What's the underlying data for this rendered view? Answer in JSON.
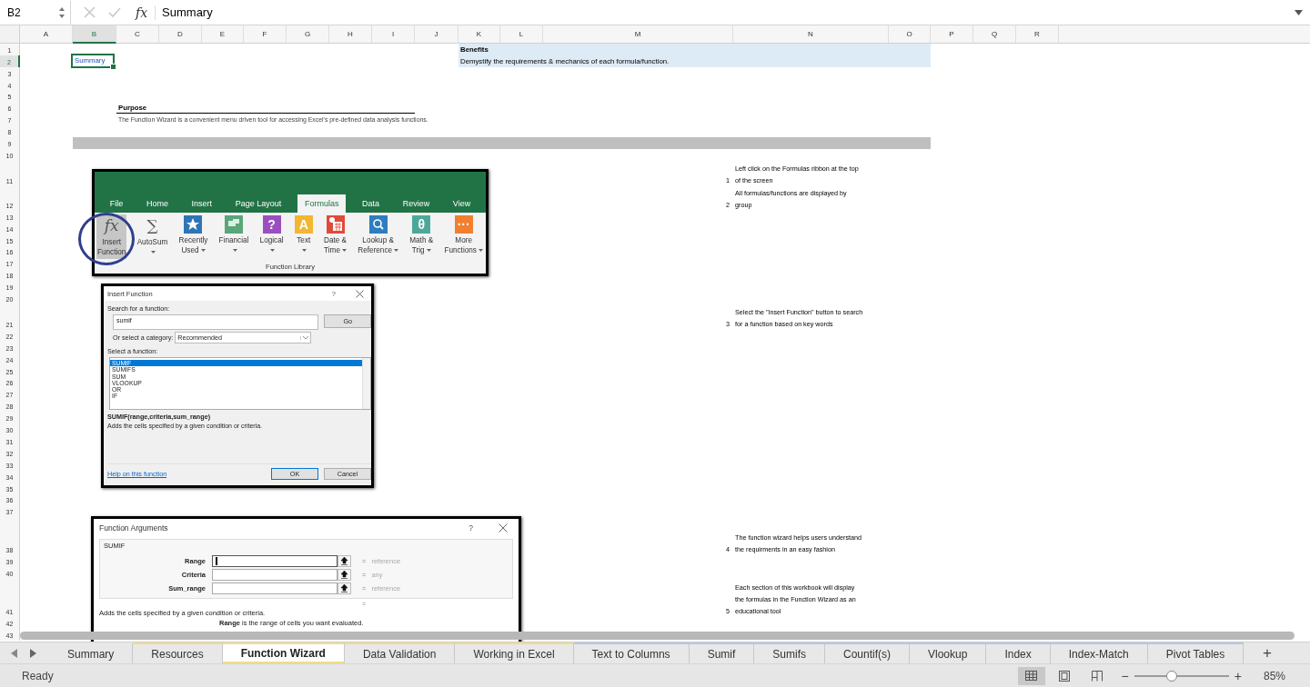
{
  "formula_bar": {
    "name_box": "B2",
    "function_glyph": "fx",
    "formula": "Summary"
  },
  "columns": [
    {
      "label": "A",
      "selected": false
    },
    {
      "label": "B",
      "selected": true
    },
    {
      "label": "C",
      "selected": false
    },
    {
      "label": "D",
      "selected": false
    },
    {
      "label": "E",
      "selected": false
    },
    {
      "label": "F",
      "selected": false
    },
    {
      "label": "G",
      "selected": false
    },
    {
      "label": "H",
      "selected": false
    },
    {
      "label": "I",
      "selected": false
    },
    {
      "label": "J",
      "selected": false
    },
    {
      "label": "K",
      "selected": false
    },
    {
      "label": "L",
      "selected": false
    },
    {
      "label": "M",
      "selected": false
    },
    {
      "label": "N",
      "selected": false
    },
    {
      "label": "O",
      "selected": false
    },
    {
      "label": "P",
      "selected": false
    },
    {
      "label": "Q",
      "selected": false
    },
    {
      "label": "R",
      "selected": false
    }
  ],
  "rows": [
    {
      "label": "1",
      "selected": false
    },
    {
      "label": "2",
      "selected": true
    },
    {
      "label": "3",
      "selected": false
    },
    {
      "label": "4",
      "selected": false
    },
    {
      "label": "5",
      "selected": false
    },
    {
      "label": "6",
      "selected": false
    },
    {
      "label": "7",
      "selected": false
    },
    {
      "label": "8",
      "selected": false
    },
    {
      "label": "9",
      "selected": false
    },
    {
      "label": "10",
      "selected": false
    },
    {
      "label": "11",
      "selected": false
    },
    {
      "label": "12",
      "selected": false
    },
    {
      "label": "13",
      "selected": false
    },
    {
      "label": "14",
      "selected": false
    },
    {
      "label": "15",
      "selected": false
    },
    {
      "label": "16",
      "selected": false
    },
    {
      "label": "17",
      "selected": false
    },
    {
      "label": "18",
      "selected": false
    },
    {
      "label": "19",
      "selected": false
    },
    {
      "label": "20",
      "selected": false
    },
    {
      "label": "21",
      "selected": false
    },
    {
      "label": "22",
      "selected": false
    },
    {
      "label": "23",
      "selected": false
    },
    {
      "label": "24",
      "selected": false
    },
    {
      "label": "25",
      "selected": false
    },
    {
      "label": "26",
      "selected": false
    },
    {
      "label": "27",
      "selected": false
    },
    {
      "label": "28",
      "selected": false
    },
    {
      "label": "29",
      "selected": false
    },
    {
      "label": "30",
      "selected": false
    },
    {
      "label": "31",
      "selected": false
    },
    {
      "label": "32",
      "selected": false
    },
    {
      "label": "33",
      "selected": false
    },
    {
      "label": "34",
      "selected": false
    },
    {
      "label": "35",
      "selected": false
    },
    {
      "label": "36",
      "selected": false
    },
    {
      "label": "37",
      "selected": false
    },
    {
      "label": "38",
      "selected": false
    },
    {
      "label": "39",
      "selected": false
    },
    {
      "label": "40",
      "selected": false
    },
    {
      "label": "41",
      "selected": false
    },
    {
      "label": "42",
      "selected": false
    },
    {
      "label": "43",
      "selected": false
    }
  ],
  "shading": [
    {
      "kind": "tint"
    },
    {
      "kind": "band"
    },
    {
      "kind": "underline"
    }
  ],
  "cells": [
    {
      "text": "Summary",
      "kind": "link",
      "selected": true
    },
    {
      "text": "Benefits",
      "kind": "bold",
      "selected": false
    },
    {
      "text": "Demystify the requirements & mechanics of each formula/function.",
      "kind": "plain",
      "selected": false
    },
    {
      "text": "Purpose",
      "kind": "bold",
      "selected": false
    },
    {
      "text": "The Function Wizard is a convenient menu driven tool for accessing Excel's pre-defined data analysis functions.",
      "kind": "note",
      "selected": false
    },
    {
      "text": "1",
      "kind": "step",
      "selected": false
    },
    {
      "text": "Left click on the Formulas ribbon at the top\nof the screen",
      "kind": "wrap",
      "selected": false
    },
    {
      "text": "2",
      "kind": "step",
      "selected": false
    },
    {
      "text": "All formulas/functions are displayed by\ngroup",
      "kind": "wrap",
      "selected": false
    },
    {
      "text": "3",
      "kind": "step",
      "selected": false
    },
    {
      "text": "Select the \"Insert Function\" button to search\nfor a function based on key words",
      "kind": "wrap",
      "selected": false
    },
    {
      "text": "4",
      "kind": "step",
      "selected": false
    },
    {
      "text": "The function wizard helps users understand\nthe requirments in an easy fashion",
      "kind": "wrap",
      "selected": false
    },
    {
      "text": "5",
      "kind": "step",
      "selected": false
    },
    {
      "text": "Each section of this workbook will display\nthe formulas in the Function Wizard as an\neducational tool",
      "kind": "wrap",
      "selected": false
    }
  ],
  "ribbon_screenshot": {
    "tabs": [
      {
        "label": "File",
        "selected": false
      },
      {
        "label": "Home",
        "selected": false
      },
      {
        "label": "Insert",
        "selected": false
      },
      {
        "label": "Page Layout",
        "selected": false
      },
      {
        "label": "Formulas",
        "selected": true
      },
      {
        "label": "Data",
        "selected": false
      },
      {
        "label": "Review",
        "selected": false
      },
      {
        "label": "View",
        "selected": false
      }
    ],
    "buttons": [
      {
        "label": "Insert\nFunction",
        "icon": {
          "kind": "plain-glyph",
          "glyph": "fx"
        },
        "dropdown": false,
        "pressed": true
      },
      {
        "label": "AutoSum",
        "icon": {
          "kind": "plain-glyph",
          "glyph": "∑"
        },
        "dropdown": true,
        "pressed": false
      },
      {
        "label": "Recently\nUsed",
        "icon": {
          "kind": "star",
          "color": "#2e75b6"
        },
        "dropdown": true,
        "pressed": false
      },
      {
        "label": "Financial",
        "icon": {
          "kind": "book",
          "color": "#5aa57a"
        },
        "dropdown": true,
        "pressed": false
      },
      {
        "label": "Logical",
        "icon": {
          "kind": "glyph",
          "glyph": "?",
          "color": "#9b4fbf"
        },
        "dropdown": true,
        "pressed": false
      },
      {
        "label": "Text",
        "icon": {
          "kind": "glyph",
          "glyph": "A",
          "color": "#f2b632"
        },
        "dropdown": true,
        "pressed": false
      },
      {
        "label": "Date &\nTime",
        "icon": {
          "kind": "calendar",
          "color": "#e04a3a"
        },
        "dropdown": true,
        "pressed": false
      },
      {
        "label": "Lookup &\nReference",
        "icon": {
          "kind": "magnifier",
          "color": "#2e7dc0"
        },
        "dropdown": true,
        "pressed": false
      },
      {
        "label": "Math &\nTrig",
        "icon": {
          "kind": "glyph",
          "glyph": "θ",
          "color": "#4ea89a"
        },
        "dropdown": true,
        "pressed": false
      },
      {
        "label": "More\nFunctions",
        "icon": {
          "kind": "glyph",
          "glyph": "···",
          "color": "#f08030"
        },
        "dropdown": true,
        "pressed": false
      }
    ],
    "group": "Function Library",
    "highlight": true
  },
  "insert_function_dialog": {
    "title": "Insert Function",
    "help": "?",
    "search_label": "Search for a function:",
    "search_value": "sumif",
    "go": "Go",
    "category_label": "Or select a category:",
    "category": "Recommended",
    "list_label": "Select a function:",
    "functions": [
      {
        "name": "SUMIF",
        "selected": true
      },
      {
        "name": "SUMIFS",
        "selected": false
      },
      {
        "name": "SUM",
        "selected": false
      },
      {
        "name": "VLOOKUP",
        "selected": false
      },
      {
        "name": "OR",
        "selected": false
      },
      {
        "name": "IF",
        "selected": false
      }
    ],
    "signature": "SUMIF(range,criteria,sum_range)",
    "description": "Adds the cells specified by a given condition or criteria.",
    "help_link": "Help on this function",
    "ok": "OK",
    "cancel": "Cancel"
  },
  "function_arguments_dialog": {
    "title": "Function Arguments",
    "help": "?",
    "function": "SUMIF",
    "arguments": [
      {
        "label": "Range",
        "focused": true,
        "equals": "=",
        "result": "reference"
      },
      {
        "label": "Criteria",
        "focused": false,
        "equals": "=",
        "result": "any"
      },
      {
        "label": "Sum_range",
        "focused": false,
        "equals": "=",
        "result": "reference"
      }
    ],
    "result": "=",
    "description": "Adds the cells specified by a given condition or criteria.",
    "argument_help": "**Range**   is the range of cells you want evaluated."
  },
  "sheet_tabs": [
    {
      "label": "Summary",
      "selected": false
    },
    {
      "label": "Resources",
      "selected": false,
      "color": "#f1dc8c"
    },
    {
      "label": "Function Wizard",
      "selected": true,
      "color": "#f1dc8c"
    },
    {
      "label": "Data Validation",
      "selected": false,
      "color": "#f1dc8c"
    },
    {
      "label": "Working in Excel",
      "selected": false,
      "color": "#f1dc8c"
    },
    {
      "label": "Text to Columns",
      "selected": false,
      "color": "#b8c4e8"
    },
    {
      "label": "Sumif",
      "selected": false,
      "color": "#b8c4e8"
    },
    {
      "label": "Sumifs",
      "selected": false,
      "color": "#b8c4e8"
    },
    {
      "label": "Countif(s)",
      "selected": false,
      "color": "#b8c4e8"
    },
    {
      "label": "Vlookup",
      "selected": false,
      "color": "#b8c4e8"
    },
    {
      "label": "Index",
      "selected": false,
      "color": "#b8c4e8"
    },
    {
      "label": "Index-Match",
      "selected": false,
      "color": "#b8c4e8"
    },
    {
      "label": "Pivot Tables",
      "selected": false,
      "color": "#b8c4e8"
    }
  ],
  "add_sheet": "+",
  "status_bar": {
    "status": "Ready",
    "views": [
      {
        "kind": "normal",
        "selected": true
      },
      {
        "kind": "page-layout",
        "selected": false
      },
      {
        "kind": "page-break",
        "selected": false
      }
    ],
    "zoom_out": "−",
    "zoom_slider": {
      "level": 0.4
    },
    "zoom_in": "+",
    "zoom_label": "85%"
  }
}
